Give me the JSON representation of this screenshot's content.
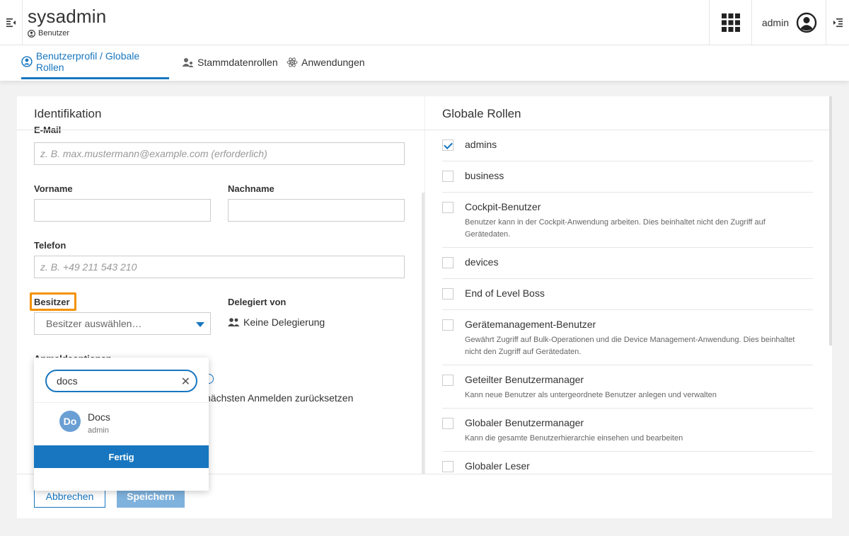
{
  "header": {
    "app_title": "sysadmin",
    "breadcrumb": "Benutzer",
    "user_name": "admin"
  },
  "tabs": [
    {
      "label": "Benutzerprofil / Globale Rollen",
      "active": true
    },
    {
      "label": "Stammdatenrollen",
      "active": false
    },
    {
      "label": "Anwendungen",
      "active": false
    }
  ],
  "identification": {
    "title": "Identifikation",
    "email_label": "E-Mail",
    "email_placeholder": "z. B. max.mustermann@example.com (erforderlich)",
    "firstname_label": "Vorname",
    "lastname_label": "Nachname",
    "phone_label": "Telefon",
    "phone_placeholder": "z. B. +49 211 543 210",
    "owner_label": "Besitzer",
    "owner_select_placeholder": "Besitzer auswählen…",
    "delegated_label": "Delegiert von",
    "delegated_value": "Keine Delegierung",
    "login_options_label": "Anmeldeoptionen",
    "reset_text": "nächsten Anmelden zurücksetzen"
  },
  "owner_dropdown": {
    "search_value": "docs",
    "result_initials": "Do",
    "result_name": "Docs",
    "result_sub": "admin",
    "done_label": "Fertig"
  },
  "footer": {
    "cancel_label": "Abbrechen",
    "save_label": "Speichern"
  },
  "global_roles": {
    "title": "Globale Rollen",
    "roles": [
      {
        "name": "admins",
        "checked": true,
        "desc": ""
      },
      {
        "name": "business",
        "checked": false,
        "desc": ""
      },
      {
        "name": "Cockpit-Benutzer",
        "checked": false,
        "desc": "Benutzer kann in der Cockpit-Anwendung arbeiten. Dies beinhaltet nicht den Zugriff auf Gerätedaten."
      },
      {
        "name": "devices",
        "checked": false,
        "desc": ""
      },
      {
        "name": "End of Level Boss",
        "checked": false,
        "desc": ""
      },
      {
        "name": "Gerätemanagement-Benutzer",
        "checked": false,
        "desc": "Gewährt Zugriff auf Bulk-Operationen und die Device Management-Anwendung. Dies beinhaltet nicht den Zugriff auf Gerätedaten."
      },
      {
        "name": "Geteilter Benutzermanager",
        "checked": false,
        "desc": "Kann neue Benutzer als untergeordnete Benutzer anlegen und verwalten"
      },
      {
        "name": "Globaler Benutzermanager",
        "checked": false,
        "desc": "Kann die gesamte Benutzerhierarchie einsehen und bearbeiten"
      },
      {
        "name": "Globaler Leser",
        "checked": false,
        "desc": ""
      }
    ]
  },
  "colors": {
    "accent": "#1776bf",
    "highlight": "#f39200",
    "save_disabled": "#7fb2dd",
    "avatar": "#6a9fd4"
  }
}
